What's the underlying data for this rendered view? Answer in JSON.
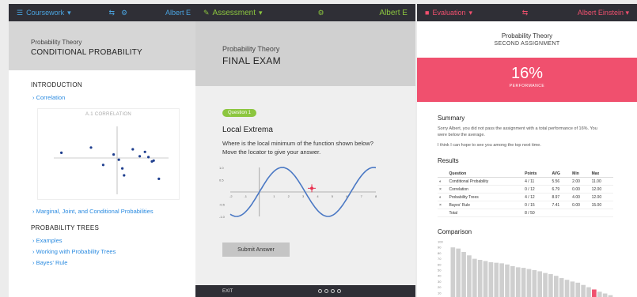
{
  "panel1": {
    "app_name": "Coursework",
    "user": "Albert E",
    "subject": "Probability Theory",
    "title": "CONDITIONAL PROBABILITY",
    "section1": "INTRODUCTION",
    "links1": [
      "Correlation"
    ],
    "chart_title": "A.1 CORRELATION",
    "link_after_chart": "Marginal, Joint, and Conditional Probabilities",
    "section2": "PROBABILITY TREES",
    "links2": [
      "Examples",
      "Working with Probability Trees",
      "Bayes' Rule"
    ]
  },
  "panel2": {
    "app_name": "Assessment",
    "user": "Albert E",
    "subject": "Probability Theory",
    "title": "FINAL EXAM",
    "badge": "Question 1",
    "question_title": "Local Extrema",
    "question_text": "Where is the local minimum of the function shown below? Move the locator to give your answer.",
    "y_ticks": [
      "1.0",
      "0.5",
      "-0.5",
      "-1.0"
    ],
    "x_ticks": [
      "-2",
      "-1",
      "1",
      "2",
      "3",
      "4",
      "5",
      "6",
      "7",
      "8"
    ],
    "submit_label": "Submit Answer",
    "footer_label": "EXIT"
  },
  "panel3": {
    "app_name": "Evaluation",
    "user": "Albert Einstein",
    "subject": "Probability Theory",
    "title": "SECOND ASSIGNMENT",
    "score": "16%",
    "score_label": "PERFORMANCE",
    "summary_head": "Summary",
    "summary_text": "Sorry Albert, you did not pass the assignment with a total performance of 16%. You were below the average.",
    "summary_text2": "I think I can hope to see you among the top next time.",
    "results_head": "Results",
    "table_headers": [
      "Question",
      "Points",
      "AVG",
      "Min",
      "Max"
    ],
    "table_rows": [
      [
        "Conditional Probability",
        "4 / 11",
        "5.56",
        "2.00",
        "11.00"
      ],
      [
        "Correlation",
        "0 / 12",
        "6.79",
        "0.00",
        "12.00"
      ],
      [
        "Probability Trees",
        "4 / 12",
        "8.97",
        "4.00",
        "12.00"
      ],
      [
        "Bayes' Rule",
        "0 / 15",
        "7.41",
        "0.00",
        "15.00"
      ],
      [
        "Total",
        "8 / 50",
        "",
        "",
        ""
      ]
    ],
    "comparison_head": "Comparison",
    "bar_y_ticks": [
      "100",
      "90",
      "80",
      "70",
      "60",
      "50",
      "40",
      "30",
      "20",
      "10",
      "0"
    ],
    "accent": "#f0506e"
  },
  "chart_data": [
    {
      "type": "scatter",
      "title": "A.1 CORRELATION",
      "x": [
        -3.2,
        -1.5,
        -0.8,
        -0.2,
        0.1,
        0.3,
        0.9,
        1.3,
        1.6,
        2.0,
        2.4,
        0.4,
        1.8,
        2.1
      ],
      "y": [
        0.3,
        0.6,
        -0.4,
        0.2,
        -0.1,
        -0.6,
        0.5,
        0.1,
        0.35,
        -0.2,
        -1.2,
        -1.0,
        0.05,
        -0.15
      ]
    },
    {
      "type": "line",
      "function": "sin",
      "x_range": [
        -2,
        8
      ],
      "y_range": [
        -1.0,
        1.0
      ],
      "locator": {
        "x": 3.6,
        "y": 0.15
      }
    },
    {
      "type": "bar",
      "values": [
        90,
        88,
        82,
        76,
        70,
        68,
        66,
        64,
        63,
        62,
        60,
        57,
        55,
        54,
        52,
        50,
        48,
        45,
        43,
        40,
        36,
        33,
        30,
        28,
        24,
        20,
        16,
        12,
        9,
        6
      ],
      "highlight_index": 26,
      "ylim": [
        0,
        100
      ]
    }
  ]
}
